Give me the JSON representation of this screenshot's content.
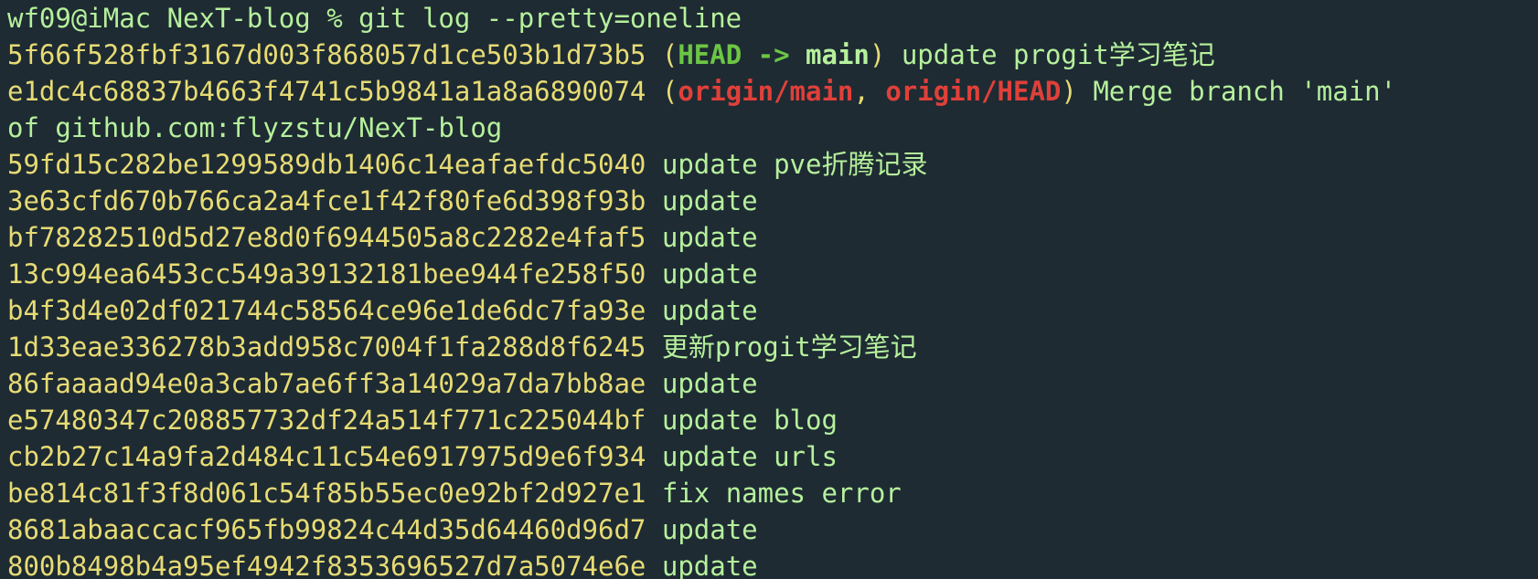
{
  "terminal": {
    "prompt": "wf09@iMac NexT-blog % ",
    "command": "git log --pretty=oneline",
    "commits": [
      {
        "hash": "5f66f528fbf3167d003f868057d1ce503b1d73b5",
        "refs": {
          "head": "HEAD",
          "arrow": "->",
          "branch": "main"
        },
        "message": "update progit学习笔记"
      },
      {
        "hash": "e1dc4c68837b4663f4741c5b9841a1a8a6890074",
        "refs": {
          "remote1": "origin/main",
          "remote2": "origin/HEAD"
        },
        "message": "Merge branch 'main'",
        "message_cont": "of github.com:flyzstu/NexT-blog"
      },
      {
        "hash": "59fd15c282be1299589db1406c14eafaefdc5040",
        "message": "update pve折腾记录"
      },
      {
        "hash": "3e63cfd670b766ca2a4fce1f42f80fe6d398f93b",
        "message": "update"
      },
      {
        "hash": "bf78282510d5d27e8d0f6944505a8c2282e4faf5",
        "message": "update"
      },
      {
        "hash": "13c994ea6453cc549a39132181bee944fe258f50",
        "message": "update"
      },
      {
        "hash": "b4f3d4e02df021744c58564ce96e1de6dc7fa93e",
        "message": "update"
      },
      {
        "hash": "1d33eae336278b3add958c7004f1fa288d8f6245",
        "message": "更新progit学习笔记"
      },
      {
        "hash": "86faaaad94e0a3cab7ae6ff3a14029a7da7bb8ae",
        "message": "update"
      },
      {
        "hash": "e57480347c208857732df24a514f771c225044bf",
        "message": "update blog"
      },
      {
        "hash": "cb2b27c14a9fa2d484c11c54e6917975d9e6f934",
        "message": "update urls"
      },
      {
        "hash": "be814c81f3f8d061c54f85b55ec0e92bf2d927e1",
        "message": "fix names error"
      },
      {
        "hash": "8681abaaccacf965fb99824c44d35d64460d96d7",
        "message": "update"
      },
      {
        "hash": "800b8498b4a95ef4942f8353696527d7a5074e6e",
        "message": "update"
      }
    ]
  },
  "colors": {
    "background": "#1e2b33",
    "hash": "#e7db74",
    "message": "#b6f09c",
    "head_ref": "#6cc644",
    "remote_ref": "#e0403a"
  }
}
